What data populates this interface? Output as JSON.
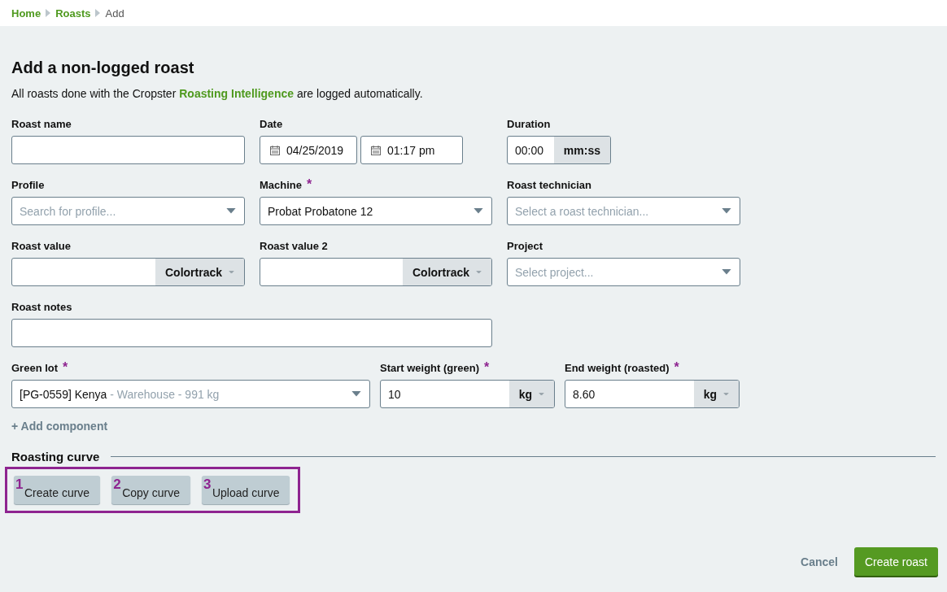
{
  "breadcrumb": [
    {
      "label": "Home",
      "kind": "link"
    },
    {
      "label": "Roasts",
      "kind": "link"
    },
    {
      "label": "Add",
      "kind": "current"
    }
  ],
  "title": "Add a non-logged roast",
  "required_mark": "*",
  "intro": {
    "before": "All roasts done with the Cropster ",
    "link": "Roasting Intelligence",
    "after": " are logged automatically."
  },
  "fields": [
    {
      "label": "Roast name",
      "kind": "text",
      "required": false
    },
    {
      "label": "Date",
      "kind": "datetime",
      "required": false,
      "date": "04/25/2019",
      "time": "01:17 pm"
    },
    {
      "label": "Duration",
      "kind": "duration",
      "required": false,
      "value": "00:00",
      "unit": "mm:ss"
    },
    {
      "label": "Profile",
      "kind": "select",
      "required": false,
      "placeholder": "Search for profile..."
    },
    {
      "label": "Machine",
      "kind": "select",
      "required": true,
      "value": "Probat Probatone 12"
    },
    {
      "label": "Roast technician",
      "kind": "select",
      "required": false,
      "placeholder": "Select a roast technician..."
    },
    {
      "label": "Roast value",
      "kind": "unit",
      "required": false,
      "unit": "Colortrack"
    },
    {
      "label": "Roast value 2",
      "kind": "unit",
      "required": false,
      "unit": "Colortrack"
    },
    {
      "label": "Project",
      "kind": "select",
      "required": false,
      "placeholder": "Select project..."
    },
    {
      "label": "Roast notes",
      "kind": "text",
      "required": false,
      "wide": true
    }
  ],
  "lot_row": [
    {
      "label": "Green lot",
      "kind": "select",
      "required": true,
      "value": "[PG-0559] Kenya",
      "detail": " - Warehouse - 991 kg"
    },
    {
      "label": "Start weight (green)",
      "kind": "unit",
      "required": true,
      "value": "10",
      "unit": "kg"
    },
    {
      "label": "End weight (roasted)",
      "kind": "unit",
      "required": true,
      "value": "8.60",
      "unit": "kg"
    }
  ],
  "add_component": "+ Add component",
  "curve": {
    "title": "Roasting curve",
    "highlighted": true,
    "steps": [
      {
        "number": "1",
        "label": "Create curve"
      },
      {
        "number": "2",
        "label": "Copy curve"
      },
      {
        "number": "3",
        "label": "Upload curve"
      }
    ]
  },
  "footer": {
    "cancel": "Cancel",
    "submit": "Create roast"
  }
}
